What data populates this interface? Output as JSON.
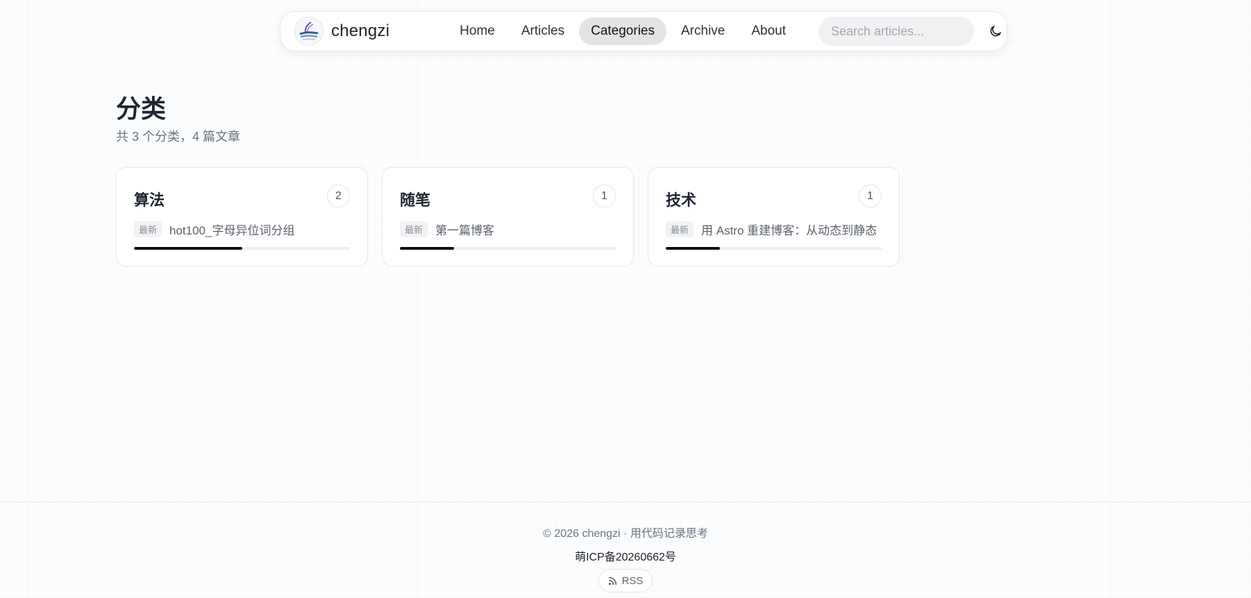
{
  "nav": {
    "brand": "chengzi",
    "links": [
      {
        "label": "Home",
        "active": false
      },
      {
        "label": "Articles",
        "active": false
      },
      {
        "label": "Categories",
        "active": true
      },
      {
        "label": "Archive",
        "active": false
      },
      {
        "label": "About",
        "active": false
      }
    ],
    "search_placeholder": "Search articles...",
    "theme_icon": "moon-icon"
  },
  "page": {
    "title": "分类",
    "subtitle": "共 3 个分类，4 篇文章"
  },
  "categories": [
    {
      "name": "算法",
      "count": "2",
      "badge": "最新",
      "latest": "hot100_字母异位词分组",
      "share": 0.5
    },
    {
      "name": "随笔",
      "count": "1",
      "badge": "最新",
      "latest": "第一篇博客",
      "share": 0.25
    },
    {
      "name": "技术",
      "count": "1",
      "badge": "最新",
      "latest": "用 Astro 重建博客：从动态到静态",
      "share": 0.25
    }
  ],
  "footer": {
    "copyright": "© 2026 chengzi · 用代码记录思考",
    "icp": "萌ICP备20260662号",
    "rss_label": "RSS",
    "rss_icon": "rss-icon"
  },
  "colors": {
    "accent": "#0d0d0d",
    "active_tab_bg": "#e2e3e5"
  }
}
